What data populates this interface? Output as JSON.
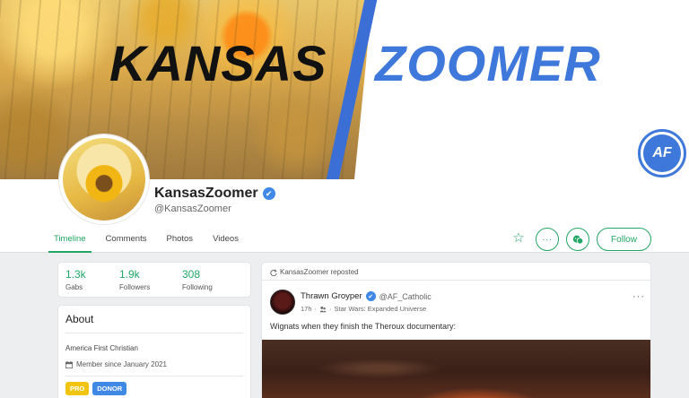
{
  "banner": {
    "title_left": "KANSAS",
    "title_right": "ZOOMER",
    "logo_text": "AF",
    "accent_color": "#3f78db"
  },
  "profile": {
    "display_name": "KansasZoomer",
    "handle": "@KansasZoomer",
    "verified_icon": "✔"
  },
  "tabs": [
    {
      "label": "Timeline",
      "active": true
    },
    {
      "label": "Comments",
      "active": false
    },
    {
      "label": "Photos",
      "active": false
    },
    {
      "label": "Videos",
      "active": false
    }
  ],
  "actions": {
    "star_icon": "☆",
    "more_icon": "···",
    "chat_icon": "chat-icon",
    "follow_label": "Follow",
    "accent_color": "#21a665"
  },
  "stats": [
    {
      "value": "1.3k",
      "label": "Gabs"
    },
    {
      "value": "1.9k",
      "label": "Followers"
    },
    {
      "value": "308",
      "label": "Following"
    }
  ],
  "about": {
    "title": "About",
    "bio": "America First Christian",
    "member_since": "Member since January 2021",
    "badges": [
      "PRO",
      "DONOR"
    ]
  },
  "post": {
    "repost_label": "KansasZoomer reposted",
    "author_name": "Thrawn Groyper",
    "author_handle": "@AF_Catholic",
    "time": "17h",
    "separator": "·",
    "group": "Star Wars: Expanded Universe",
    "text": "Wignats when they finish the Theroux documentary:",
    "more_icon": "···"
  }
}
